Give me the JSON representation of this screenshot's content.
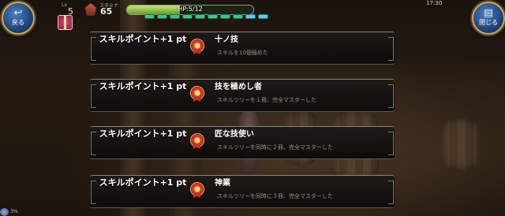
{
  "hud": {
    "back_label": "戻る",
    "close_label": "閉じる",
    "level_small": "Lv",
    "level_value": "5",
    "stamina_small": "スタミナ",
    "stamina_value": "65",
    "hp_text": "HP:5/12",
    "hp_fraction": 0.42,
    "clock": "17:30",
    "bottom_text": "3%",
    "pip_colors": [
      "#3ec48a",
      "#5fc8e8"
    ]
  },
  "achievements": [
    {
      "reward": "スキルポイント+1 pt",
      "title": "十ノ技",
      "desc": "スキルを10個極めた",
      "icon": "medal-icon"
    },
    {
      "reward": "スキルポイント+1 pt",
      "title": "技を極めし者",
      "desc": "スキルツリーを１冊、完全マスターした",
      "icon": "medal-icon"
    },
    {
      "reward": "スキルポイント+1 pt",
      "title": "匠な技使い",
      "desc": "スキルツリーを同時に２冊、完全マスターした",
      "icon": "medal-icon"
    },
    {
      "reward": "スキルポイント+1 pt",
      "title": "神業",
      "desc": "スキルツリーを同時に３冊、完全マスターした",
      "icon": "medal-icon"
    }
  ]
}
